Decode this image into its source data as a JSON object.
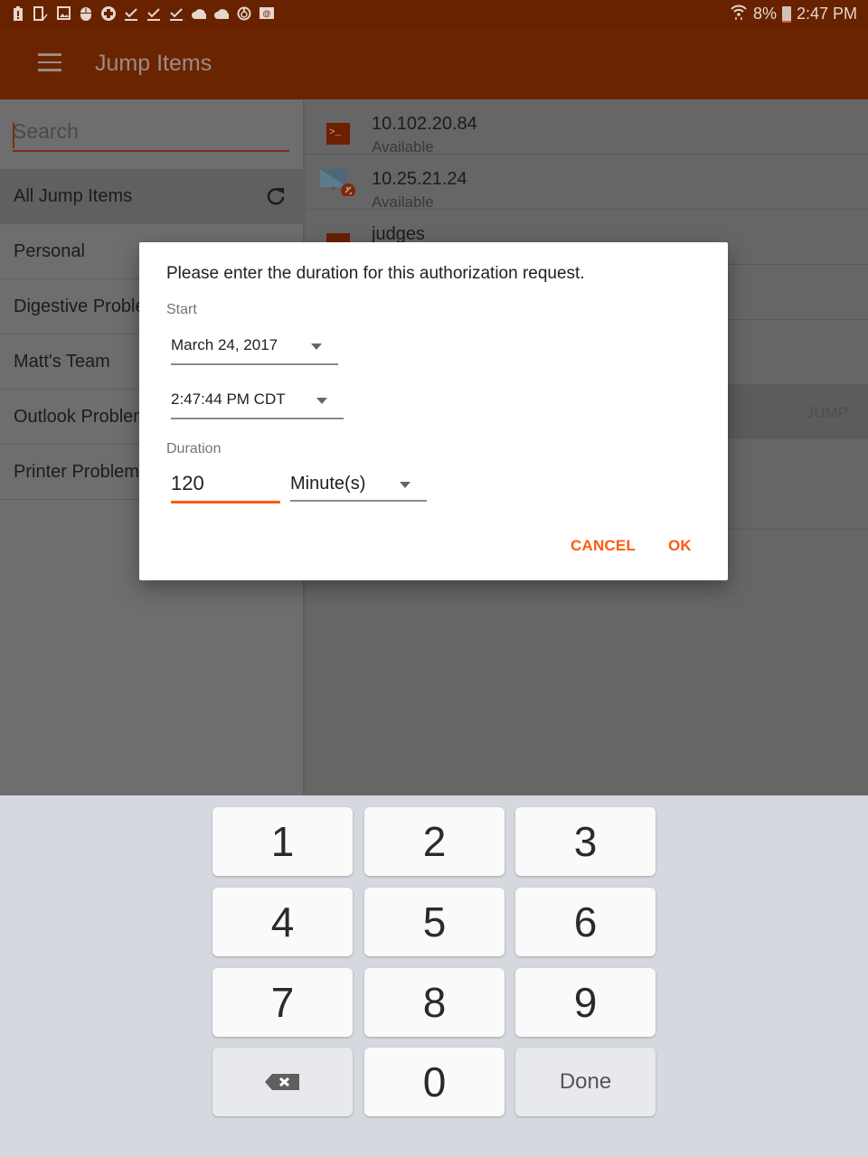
{
  "status_bar": {
    "left_icons": [
      "battery-alert-icon",
      "phone-check-icon",
      "image-icon",
      "mouse-icon",
      "plus-circle-icon",
      "download-done-icon",
      "download-done-icon",
      "download-done-icon",
      "cloud-icon",
      "cloud-icon",
      "power-target-icon",
      "email-at-icon"
    ],
    "battery_percent": "8%",
    "time": "2:47 PM"
  },
  "app_bar": {
    "title": "Jump Items"
  },
  "sidebar": {
    "search_placeholder": "Search",
    "items": [
      {
        "label": "All Jump Items",
        "active": true
      },
      {
        "label": "Personal"
      },
      {
        "label": "Digestive Problems"
      },
      {
        "label": "Matt's Team"
      },
      {
        "label": "Outlook Problems"
      },
      {
        "label": "Printer Problems"
      }
    ]
  },
  "jump_list": {
    "items": [
      {
        "title": "10.102.20.84",
        "status": "Available",
        "icon": "terminal-icon"
      },
      {
        "title": "10.25.21.24",
        "status": "Available",
        "icon": "remote-desktop-icon"
      },
      {
        "title": "judges",
        "status": "",
        "icon": "terminal-icon"
      }
    ],
    "jump_button": "JUMP"
  },
  "dialog": {
    "message": "Please enter the duration for this authorization request.",
    "start_label": "Start",
    "start_date": "March 24, 2017",
    "start_time": "2:47:44 PM CDT",
    "duration_label": "Duration",
    "duration_value": "120",
    "duration_unit": "Minute(s)",
    "cancel_label": "CANCEL",
    "ok_label": "OK",
    "accent_color": "#ff5a10"
  },
  "keypad": {
    "keys": [
      "1",
      "2",
      "3",
      "4",
      "5",
      "6",
      "7",
      "8",
      "9",
      "",
      "0",
      "Done"
    ],
    "backspace_icon": "backspace-icon"
  },
  "colors": {
    "primary_dark": "#692200",
    "primary": "#6a2400",
    "accent": "#ff5a10"
  }
}
